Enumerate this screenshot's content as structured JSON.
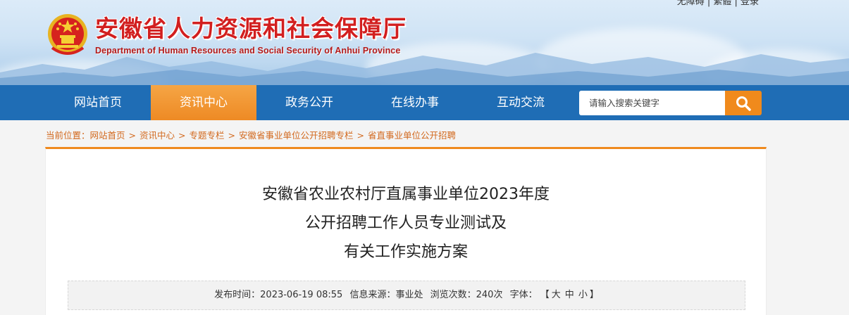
{
  "header": {
    "top_links": "无障碍 | 繁體 | 登录",
    "title": "安徽省人力资源和社会保障厅",
    "subtitle": "Department of Human Resources and Social Security of Anhui Province"
  },
  "nav": {
    "items": [
      {
        "label": "网站首页"
      },
      {
        "label": "资讯中心",
        "active": true
      },
      {
        "label": "政务公开"
      },
      {
        "label": "在线办事"
      },
      {
        "label": "互动交流"
      }
    ],
    "search_placeholder": "请输入搜索关键字",
    "search_icon": "search-icon"
  },
  "breadcrumb": {
    "prefix": "当前位置：",
    "items": [
      "网站首页",
      "资讯中心",
      "专题专栏",
      "安徽省事业单位公开招聘专栏",
      "省直事业单位公开招聘"
    ],
    "separator": ">"
  },
  "article": {
    "title_lines": [
      "安徽省农业农村厅直属事业单位2023年度",
      "公开招聘工作人员专业测试及",
      "有关工作实施方案"
    ],
    "meta": {
      "publish_label": "发布时间：",
      "publish_time": "2023-06-19 08:55",
      "source_label": "信息来源：",
      "source": "事业处",
      "views_label": "浏览次数：",
      "views": "240次",
      "font_label": "字体：",
      "bracket_open": "【",
      "font_large": "大",
      "font_medium": "中",
      "font_small": "小",
      "bracket_close": "】"
    }
  },
  "colors": {
    "nav_bg": "#1f6db5",
    "nav_active": "#ee8a24",
    "accent_orange": "#ef8a1e",
    "title_red": "#d21f1f"
  }
}
